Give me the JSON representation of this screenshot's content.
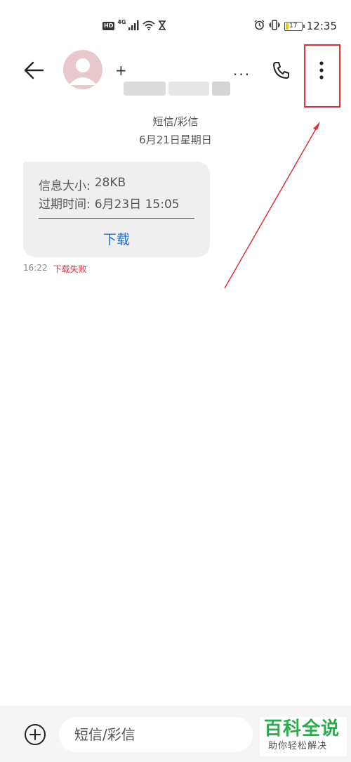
{
  "status_bar": {
    "hd_label": "HD",
    "network_label": "4G",
    "time": "12:35",
    "battery_level": "17",
    "battery_fraction": 0.17,
    "battery_color": "#f1c40f",
    "icons": [
      "hd-icon",
      "signal-icon",
      "wifi-icon",
      "hourglass-icon",
      "alarm-icon",
      "vibrate-icon",
      "battery-icon"
    ]
  },
  "header": {
    "contact_name": "+",
    "contact_name_suffix": "...",
    "icons": [
      "back-arrow-icon",
      "avatar-person-icon",
      "phone-icon",
      "more-vertical-icon"
    ]
  },
  "conversation": {
    "channel_label": "短信/彩信",
    "date_label": "6月21日星期日"
  },
  "mms": {
    "size_label": "信息大小:",
    "size_value": "28KB",
    "expiry_label": "过期时间:",
    "expiry_value": "6月23日 15:05",
    "download_label": "下载"
  },
  "message_meta": {
    "time": "16:22",
    "status": "下载失败"
  },
  "input": {
    "placeholder": "短信/彩信"
  },
  "watermark": {
    "title": "百科全说",
    "subtitle": "助你轻松解决"
  },
  "colors": {
    "accent_blue": "#1f6fd0",
    "error_red": "#d9343a",
    "annotation_red": "#d9343a",
    "watermark_green": "#2ea94f",
    "avatar_bg": "#e8c8cc"
  }
}
